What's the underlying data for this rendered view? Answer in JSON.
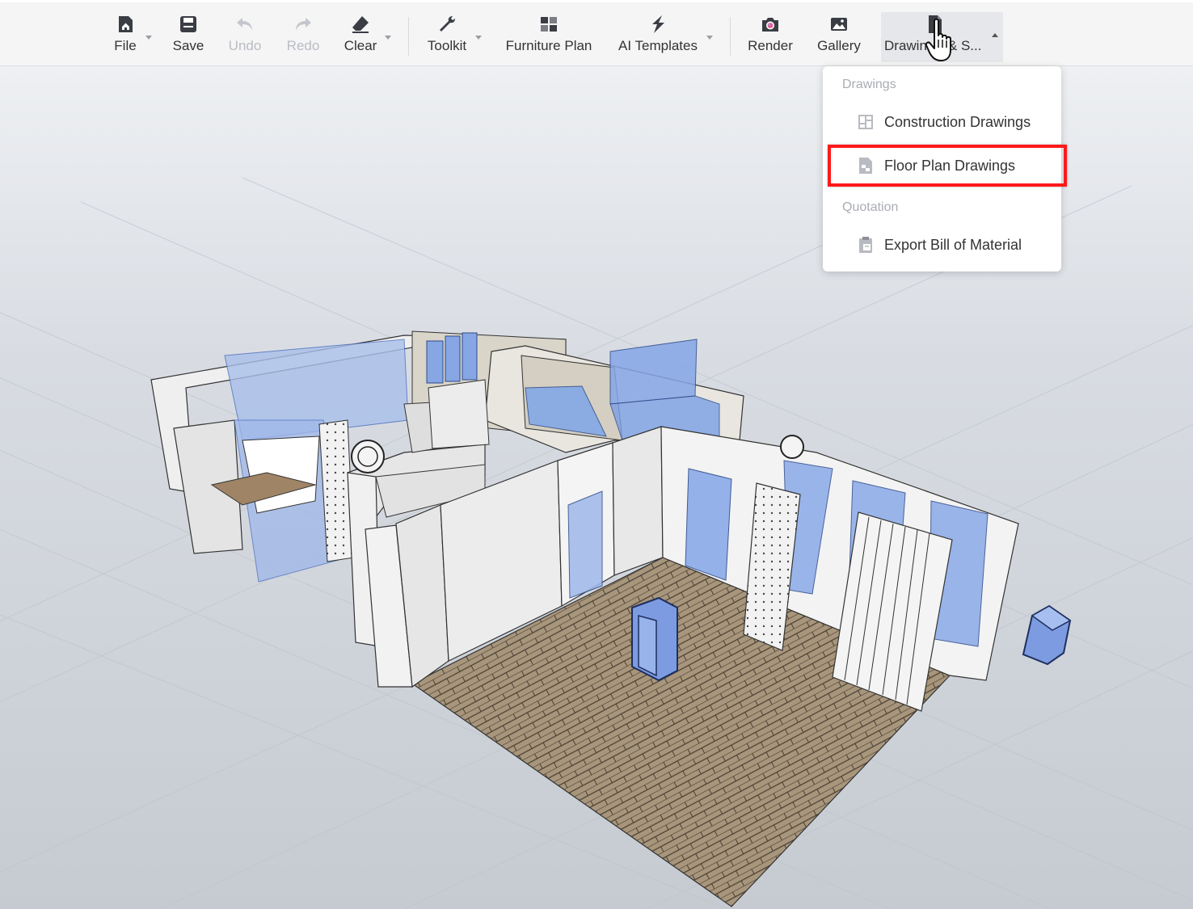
{
  "toolbar": {
    "file": {
      "label": "File",
      "icon": "file-home-icon"
    },
    "save": {
      "label": "Save",
      "icon": "save-icon"
    },
    "undo": {
      "label": "Undo",
      "icon": "undo-icon"
    },
    "redo": {
      "label": "Redo",
      "icon": "redo-icon"
    },
    "clear": {
      "label": "Clear",
      "icon": "eraser-icon"
    },
    "toolkit": {
      "label": "Toolkit",
      "icon": "wrench-icon"
    },
    "furniture_plan": {
      "label": "Furniture Plan",
      "icon": "furniture-plan-icon"
    },
    "ai_templates": {
      "label": "AI Templates",
      "icon": "ai-templates-icon"
    },
    "render": {
      "label": "Render",
      "icon": "camera-icon"
    },
    "gallery": {
      "label": "Gallery",
      "icon": "gallery-icon"
    },
    "drawings": {
      "label": "Drawin",
      "label_tail": "& S...",
      "icon": "document-icon"
    }
  },
  "dropdown": {
    "group_drawings": "Drawings",
    "construction_drawings": "Construction Drawings",
    "floor_plan_drawings": "Floor Plan Drawings",
    "group_quotation": "Quotation",
    "export_bom": "Export Bill of Material"
  },
  "colors": {
    "accent_highlight": "#ff1a1a",
    "glass_blue": "#7fa6e8",
    "wood_floor": "#a8967c"
  }
}
